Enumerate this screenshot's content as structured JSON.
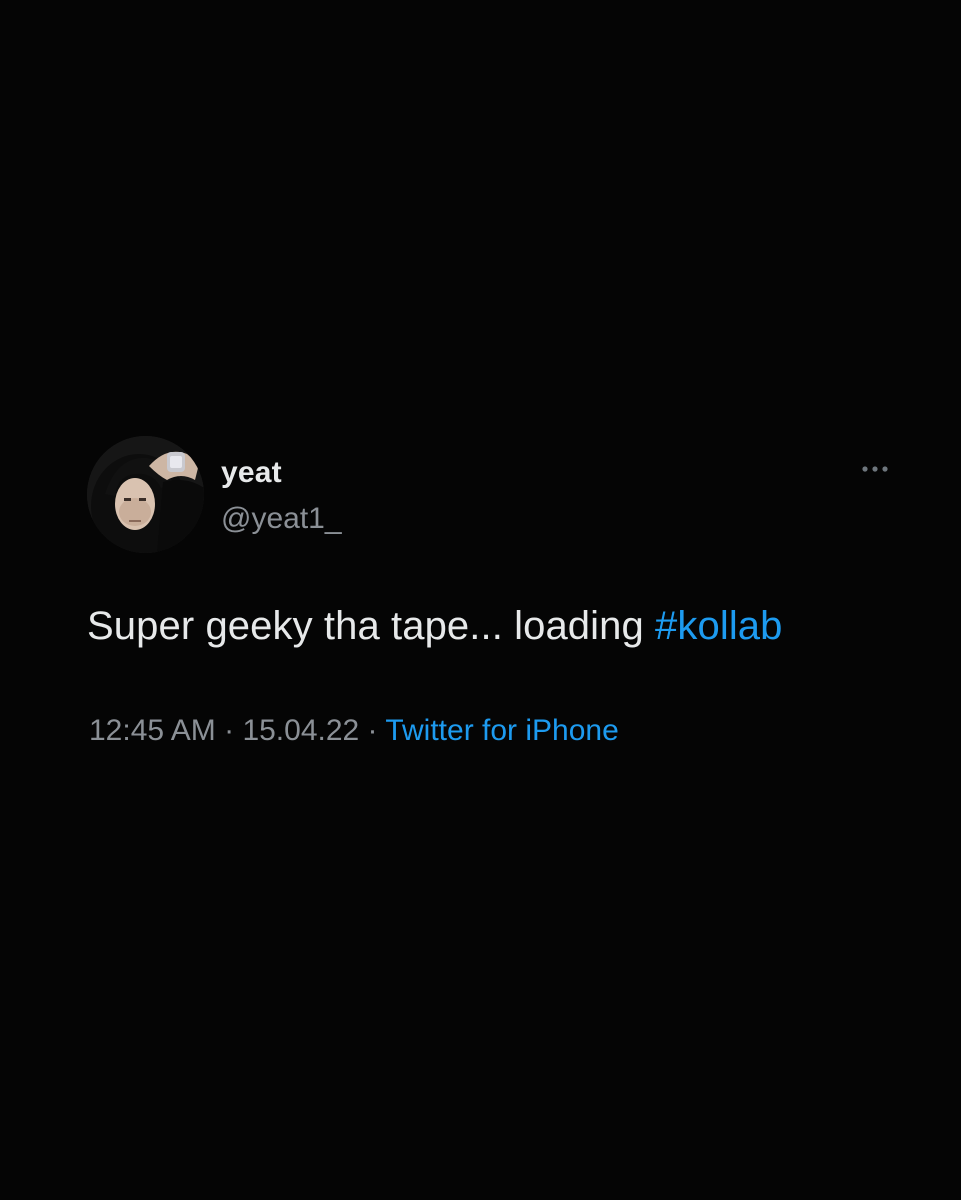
{
  "tweet": {
    "author": {
      "display_name": "yeat",
      "handle": "@yeat1_",
      "avatar": "profile-photo"
    },
    "more_icon": "ellipsis-icon",
    "text": "Super geeky tha tape... loading ",
    "hashtag": "#kollab",
    "meta": {
      "time": "12:45 AM",
      "separator": " · ",
      "date": "15.04.22",
      "separator2": " · ",
      "source": "Twitter for iPhone"
    },
    "colors": {
      "background": "#050505",
      "text": "#e7e9ea",
      "secondary": "#8b9096",
      "link": "#1d9bf0"
    }
  }
}
